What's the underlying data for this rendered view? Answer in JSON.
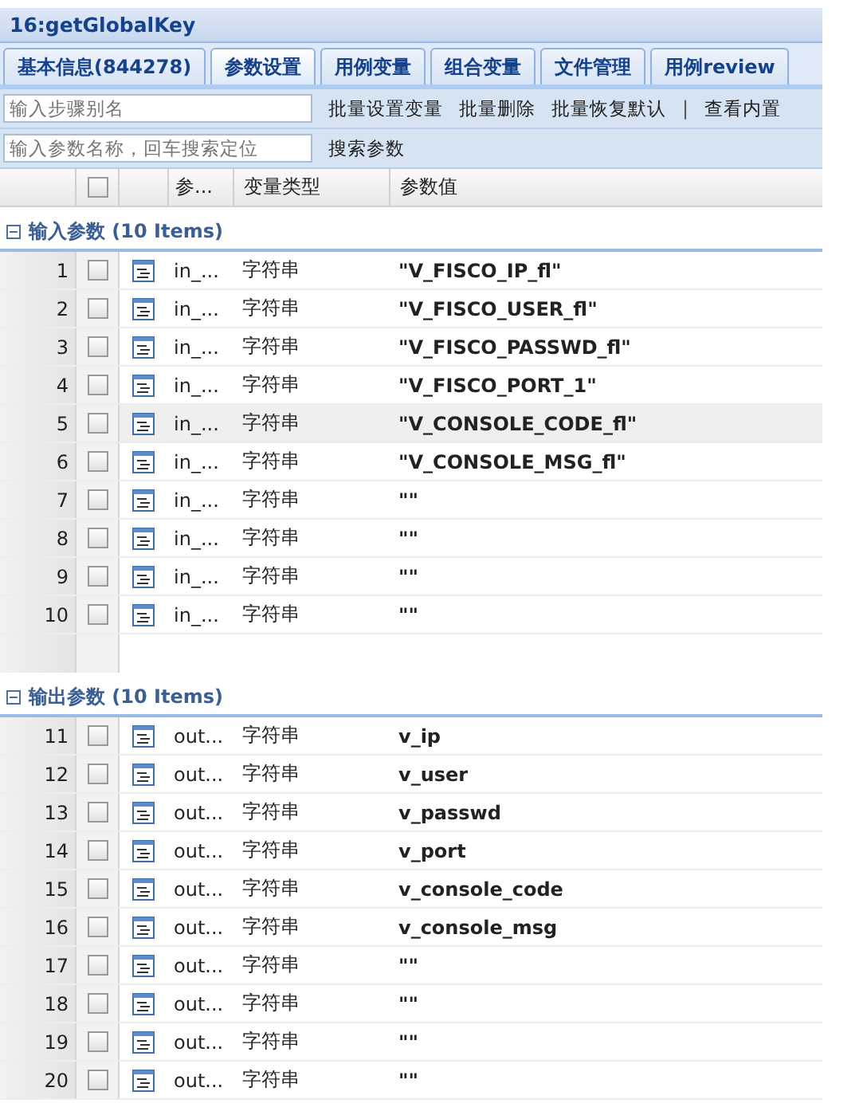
{
  "window": {
    "title": "16:getGlobalKey"
  },
  "tabs": [
    {
      "label": "基本信息(844278)",
      "selected": false
    },
    {
      "label": "参数设置",
      "selected": true
    },
    {
      "label": "用例变量",
      "selected": false
    },
    {
      "label": "组合变量",
      "selected": false
    },
    {
      "label": "文件管理",
      "selected": false
    },
    {
      "label": "用例review",
      "selected": false
    }
  ],
  "toolbar": {
    "alias_field": {
      "placeholder": "输入步骤别名"
    },
    "actions": [
      "批量设置变量",
      "批量删除",
      "批量恢复默认"
    ],
    "separator": "|",
    "more": "查看内置"
  },
  "search": {
    "field": {
      "placeholder": "输入参数名称，回车搜索定位"
    },
    "button": "搜索参数"
  },
  "table": {
    "header_checked": false,
    "columns": [
      "参...",
      "变量类型",
      "参数值"
    ],
    "groups": [
      {
        "title": "输入参数 (10 Items)",
        "expanded": true,
        "rows": [
          {
            "num": "1",
            "checked": false,
            "selected": false,
            "name": "in_...",
            "type": "字符串",
            "value": "\"V_FISCO_IP_fl\""
          },
          {
            "num": "2",
            "checked": false,
            "selected": false,
            "name": "in_...",
            "type": "字符串",
            "value": "\"V_FISCO_USER_fl\""
          },
          {
            "num": "3",
            "checked": false,
            "selected": false,
            "name": "in_...",
            "type": "字符串",
            "value": "\"V_FISCO_PASSWD_fl\""
          },
          {
            "num": "4",
            "checked": false,
            "selected": false,
            "name": "in_...",
            "type": "字符串",
            "value": "\"V_FISCO_PORT_1\""
          },
          {
            "num": "5",
            "checked": false,
            "selected": true,
            "name": "in_...",
            "type": "字符串",
            "value": "\"V_CONSOLE_CODE_fl\""
          },
          {
            "num": "6",
            "checked": false,
            "selected": false,
            "name": "in_...",
            "type": "字符串",
            "value": "\"V_CONSOLE_MSG_fl\""
          },
          {
            "num": "7",
            "checked": false,
            "selected": false,
            "name": "in_...",
            "type": "字符串",
            "value": "\"\""
          },
          {
            "num": "8",
            "checked": false,
            "selected": false,
            "name": "in_...",
            "type": "字符串",
            "value": "\"\""
          },
          {
            "num": "9",
            "checked": false,
            "selected": false,
            "name": "in_...",
            "type": "字符串",
            "value": "\"\""
          },
          {
            "num": "10",
            "checked": false,
            "selected": false,
            "name": "in_...",
            "type": "字符串",
            "value": "\"\""
          }
        ]
      },
      {
        "title": "输出参数 (10 Items)",
        "expanded": true,
        "rows": [
          {
            "num": "11",
            "checked": false,
            "selected": false,
            "name": "out...",
            "type": "字符串",
            "value": "v_ip"
          },
          {
            "num": "12",
            "checked": false,
            "selected": false,
            "name": "out...",
            "type": "字符串",
            "value": "v_user"
          },
          {
            "num": "13",
            "checked": false,
            "selected": false,
            "name": "out...",
            "type": "字符串",
            "value": "v_passwd"
          },
          {
            "num": "14",
            "checked": false,
            "selected": false,
            "name": "out...",
            "type": "字符串",
            "value": "v_port"
          },
          {
            "num": "15",
            "checked": false,
            "selected": false,
            "name": "out...",
            "type": "字符串",
            "value": "v_console_code"
          },
          {
            "num": "16",
            "checked": false,
            "selected": false,
            "name": "out...",
            "type": "字符串",
            "value": "v_console_msg"
          },
          {
            "num": "17",
            "checked": false,
            "selected": false,
            "name": "out...",
            "type": "字符串",
            "value": "\"\""
          },
          {
            "num": "18",
            "checked": false,
            "selected": false,
            "name": "out...",
            "type": "字符串",
            "value": "\"\""
          },
          {
            "num": "19",
            "checked": false,
            "selected": false,
            "name": "out...",
            "type": "字符串",
            "value": "\"\""
          },
          {
            "num": "20",
            "checked": false,
            "selected": false,
            "name": "out...",
            "type": "字符串",
            "value": "\"\""
          }
        ]
      }
    ]
  }
}
